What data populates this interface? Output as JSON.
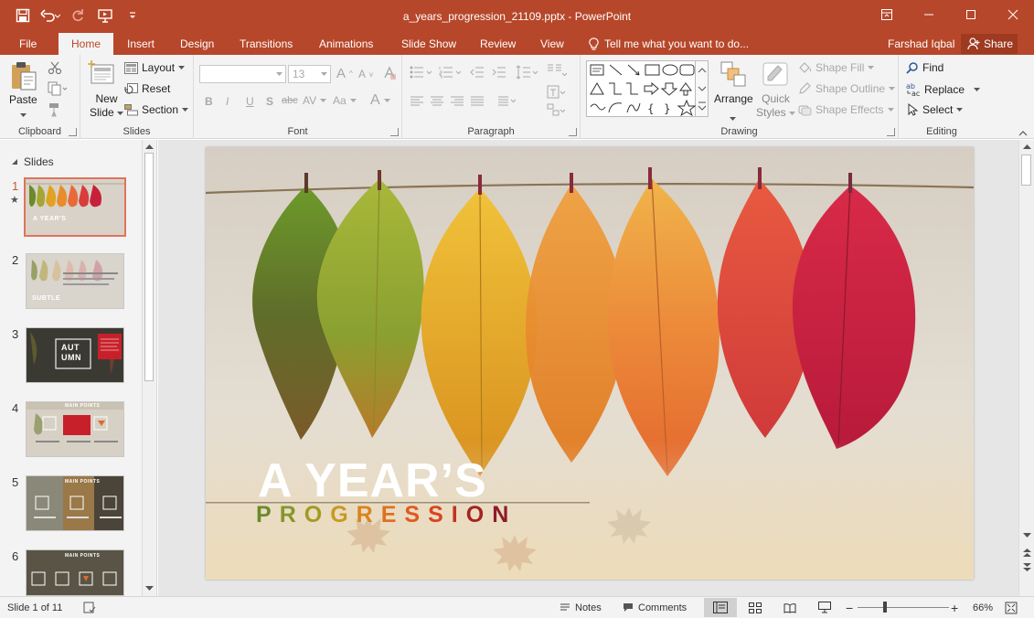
{
  "window": {
    "title": "a_years_progression_21109.pptx - PowerPoint"
  },
  "tabs": [
    {
      "label": "File"
    },
    {
      "label": "Home"
    },
    {
      "label": "Insert"
    },
    {
      "label": "Design"
    },
    {
      "label": "Transitions"
    },
    {
      "label": "Animations"
    },
    {
      "label": "Slide Show"
    },
    {
      "label": "Review"
    },
    {
      "label": "View"
    }
  ],
  "tell_me": "Tell me what you want to do...",
  "user": "Farshad Iqbal",
  "share_label": "Share",
  "ribbon": {
    "clipboard": {
      "label": "Clipboard",
      "paste": "Paste"
    },
    "slides": {
      "label": "Slides",
      "new_slide": "New",
      "new_slide_2": "Slide",
      "layout": "Layout",
      "reset": "Reset",
      "section": "Section"
    },
    "font": {
      "label": "Font",
      "font_size": "13",
      "bold": "B",
      "italic": "I",
      "underline": "U",
      "shadow": "S",
      "strike": "abc",
      "spacing": "AV",
      "case": "Aa",
      "color": "A",
      "grow": "A",
      "shrink": "A"
    },
    "paragraph": {
      "label": "Paragraph"
    },
    "drawing": {
      "label": "Drawing",
      "arrange": "Arrange",
      "quick_styles": "Quick",
      "quick_styles_2": "Styles",
      "shape_fill": "Shape Fill",
      "shape_outline": "Shape Outline",
      "shape_effects": "Shape Effects"
    },
    "editing": {
      "label": "Editing",
      "find": "Find",
      "replace": "Replace",
      "select": "Select"
    }
  },
  "slides_panel": {
    "header": "Slides",
    "thumbnails": [
      {
        "num": "1",
        "text": "A YEAR'S"
      },
      {
        "num": "2",
        "text": "SUBTLE"
      },
      {
        "num": "3",
        "text": "AUT UMN"
      },
      {
        "num": "4",
        "text": "MAIN POINTS"
      },
      {
        "num": "5",
        "text": "MAIN POINTS"
      },
      {
        "num": "6",
        "text": "MAIN POINTS"
      }
    ]
  },
  "slide": {
    "title": "A YEAR’S",
    "subtitle_letters": [
      {
        "ch": "P",
        "color": "#6b8a2a"
      },
      {
        "ch": "R",
        "color": "#85962a"
      },
      {
        "ch": "O",
        "color": "#a39a22"
      },
      {
        "ch": "G",
        "color": "#c89a1e"
      },
      {
        "ch": "R",
        "color": "#d8851d"
      },
      {
        "ch": "E",
        "color": "#e0701e"
      },
      {
        "ch": "S",
        "color": "#e05a1f"
      },
      {
        "ch": "S",
        "color": "#d8441f"
      },
      {
        "ch": "I",
        "color": "#c6321f"
      },
      {
        "ch": "O",
        "color": "#a52320"
      },
      {
        "ch": "N",
        "color": "#8e1b2a"
      }
    ]
  },
  "status": {
    "slide_of": "Slide 1 of 11",
    "notes": "Notes",
    "comments": "Comments",
    "zoom": "66%"
  },
  "colors": {
    "accent": "#b7472a"
  }
}
